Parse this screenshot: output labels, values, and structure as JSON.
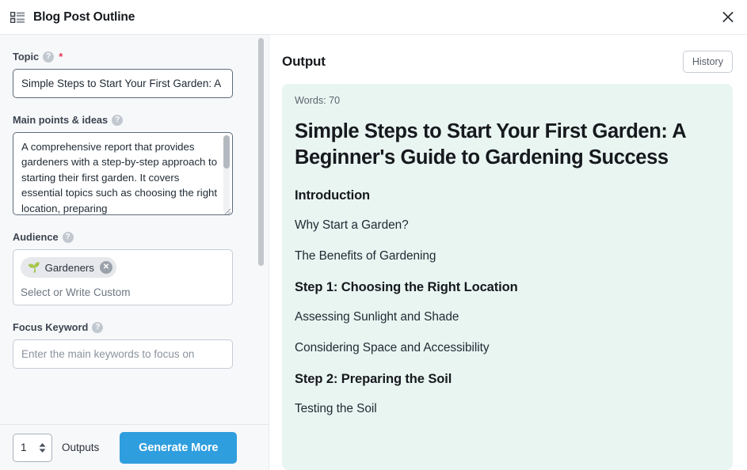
{
  "titlebar": {
    "icon": "list-icon",
    "title": "Blog Post Outline",
    "close_icon": "close-icon"
  },
  "form": {
    "topic": {
      "label": "Topic",
      "help_icon": "help-icon",
      "required_marker": "*",
      "value": "Simple Steps to Start Your First Garden: A"
    },
    "main_points": {
      "label": "Main points & ideas",
      "help_icon": "help-icon",
      "value": "A comprehensive report that provides gardeners with a step-by-step approach to starting their first garden. It covers essential topics such as choosing the right location, preparing"
    },
    "audience": {
      "label": "Audience",
      "help_icon": "help-icon",
      "tags": [
        {
          "emoji": "🌱",
          "label": "Gardeners",
          "remove_icon": "close-icon"
        }
      ],
      "placeholder": "Select or Write Custom"
    },
    "focus_keyword": {
      "label": "Focus Keyword",
      "help_icon": "help-icon",
      "placeholder": "Enter the main keywords to focus on"
    }
  },
  "bottom_bar": {
    "outputs_value": "1",
    "outputs_label": "Outputs",
    "generate_label": "Generate More"
  },
  "output": {
    "title": "Output",
    "history_label": "History",
    "words": "Words: 70",
    "doc_title": "Simple Steps to Start Your First Garden: A Beginner's Guide to Gardening Success",
    "blocks": [
      {
        "type": "h2",
        "text": "Introduction"
      },
      {
        "type": "p",
        "text": "Why Start a Garden?"
      },
      {
        "type": "p",
        "text": "The Benefits of Gardening"
      },
      {
        "type": "h2",
        "text": "Step 1: Choosing the Right Location"
      },
      {
        "type": "p",
        "text": "Assessing Sunlight and Shade"
      },
      {
        "type": "p",
        "text": "Considering Space and Accessibility"
      },
      {
        "type": "h2",
        "text": "Step 2: Preparing the Soil"
      },
      {
        "type": "p",
        "text": "Testing the Soil"
      }
    ]
  },
  "colors": {
    "accent": "#2f9ede",
    "output_card_bg": "#e9f5f1",
    "panel_bg": "#f7f8fa",
    "required": "#e8384f",
    "tag_green": "#63b34b"
  }
}
